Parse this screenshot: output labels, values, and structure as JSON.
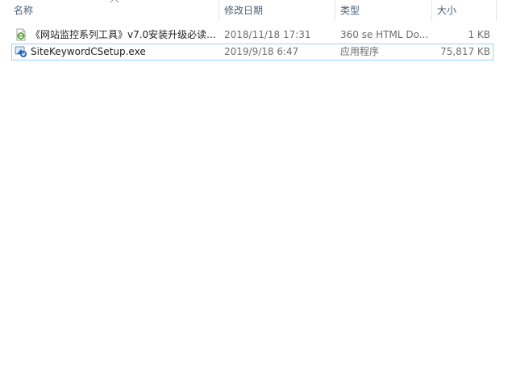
{
  "columns": {
    "name": "名称",
    "date_modified": "修改日期",
    "type": "类型",
    "size": "大小"
  },
  "sort": {
    "column": "name",
    "direction": "ascending",
    "icon": "sort-ascending-icon"
  },
  "files": [
    {
      "name": "《网站监控系列工具》v7.0安装升级必读...",
      "date_modified": "2018/11/18 17:31",
      "type": "360 se HTML Do...",
      "size": "1 KB",
      "icon": "html-document-icon",
      "icon_color": "#5aa832"
    },
    {
      "name": "SiteKeywordCSetup.exe",
      "date_modified": "2019/9/18 6:47",
      "type": "应用程序",
      "size": "75,817 KB",
      "icon": "installer-exe-icon",
      "icon_color": "#2b6cc4"
    }
  ],
  "focus_color": "#99d1ff",
  "header_text_color": "#4c607a"
}
